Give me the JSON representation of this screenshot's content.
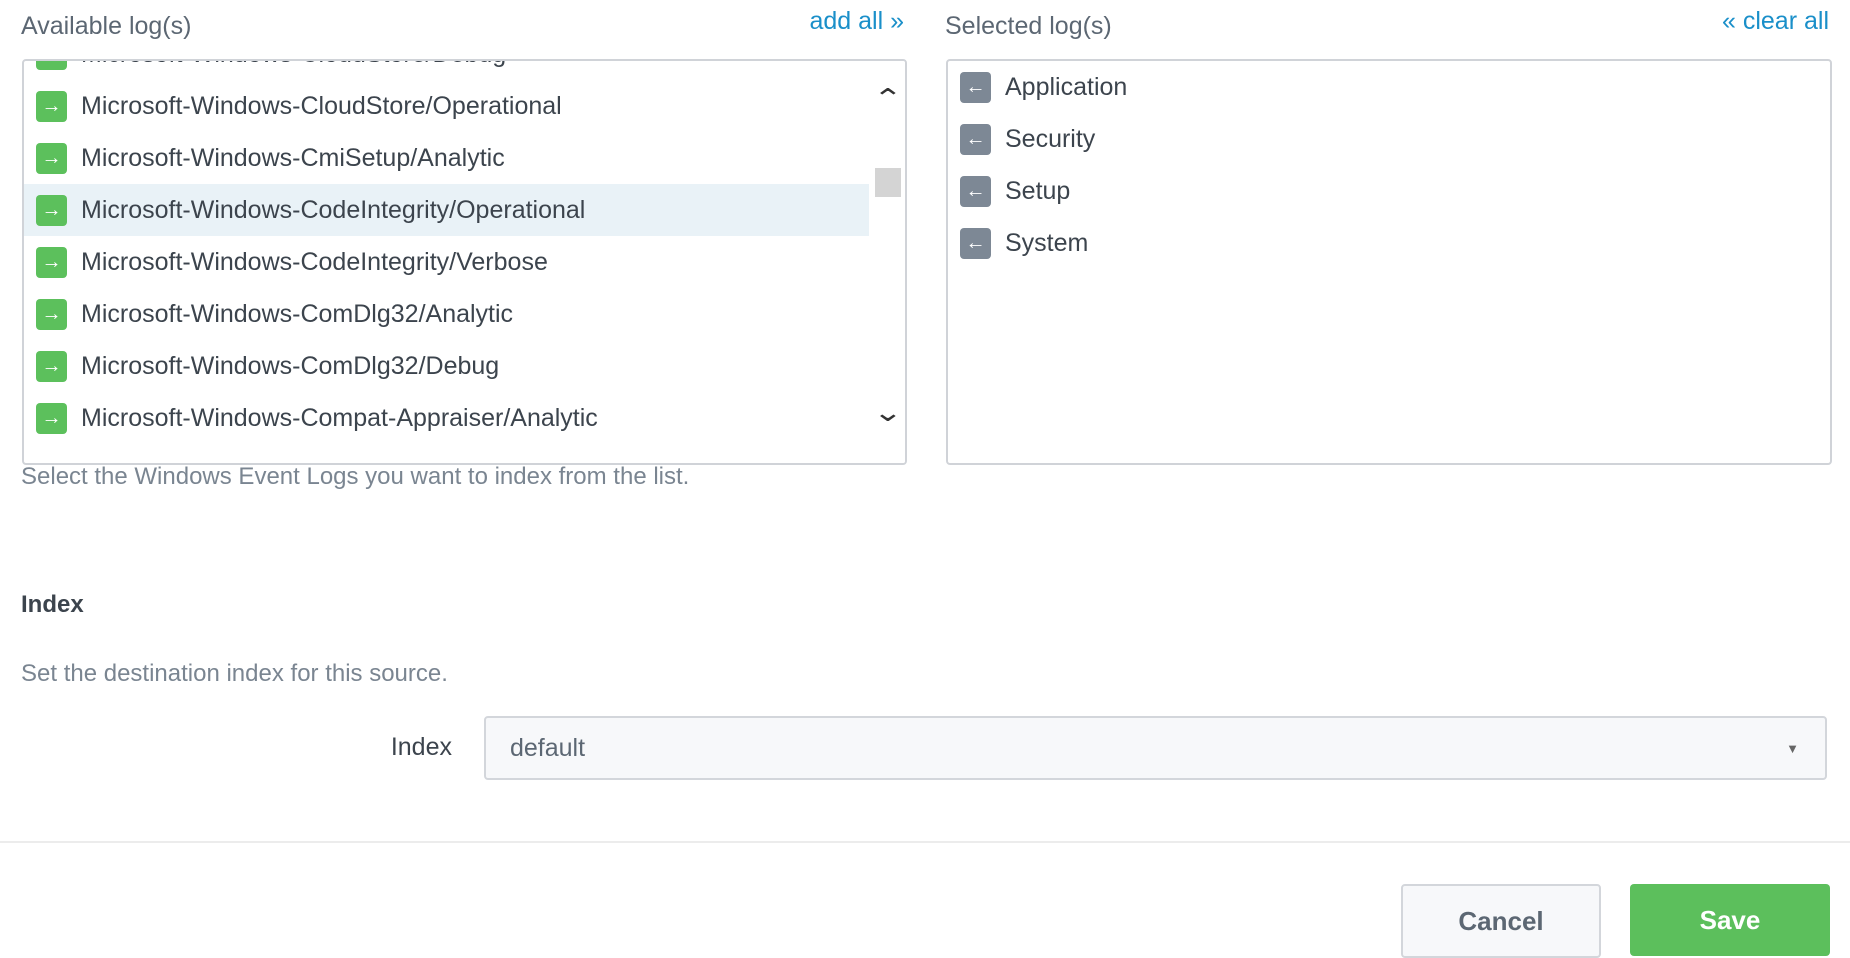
{
  "available": {
    "label": "Available log(s)",
    "add_all": "add all »",
    "items": [
      "Microsoft-Windows-CloudStore/Debug",
      "Microsoft-Windows-CloudStore/Operational",
      "Microsoft-Windows-CmiSetup/Analytic",
      "Microsoft-Windows-CodeIntegrity/Operational",
      "Microsoft-Windows-CodeIntegrity/Verbose",
      "Microsoft-Windows-ComDlg32/Analytic",
      "Microsoft-Windows-ComDlg32/Debug",
      "Microsoft-Windows-Compat-Appraiser/Analytic"
    ],
    "highlighted_index": 3,
    "icon": "arrow-right-icon",
    "help": "Select the Windows Event Logs you want to index from the list."
  },
  "selected": {
    "label": "Selected log(s)",
    "clear_all": "« clear all",
    "items": [
      "Application",
      "Security",
      "Setup",
      "System"
    ],
    "icon": "arrow-left-icon"
  },
  "index": {
    "heading": "Index",
    "help": "Set the destination index for this source.",
    "field_label": "Index",
    "value": "default"
  },
  "footer": {
    "cancel": "Cancel",
    "save": "Save"
  },
  "colors": {
    "accent": "#1a8fc9",
    "add_icon": "#5cc05c",
    "remove_icon": "#7d8895",
    "save": "#5cbf5c"
  }
}
